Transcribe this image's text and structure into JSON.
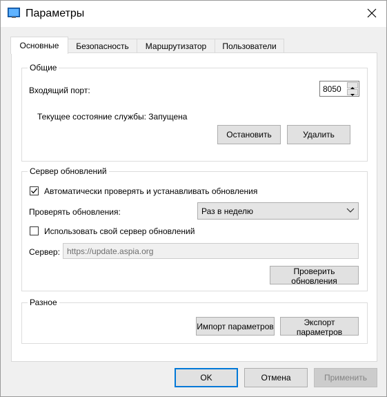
{
  "window": {
    "title": "Параметры"
  },
  "tabs": [
    {
      "label": "Основные"
    },
    {
      "label": "Безопасность"
    },
    {
      "label": "Маршрутизатор"
    },
    {
      "label": "Пользователи"
    }
  ],
  "general": {
    "legend": "Общие",
    "port_label": "Входящий порт:",
    "port_value": "8050",
    "service_status": "Текущее состояние службы: Запущена",
    "stop_button": "Остановить",
    "remove_button": "Удалить"
  },
  "updates": {
    "legend": "Сервер обновлений",
    "auto_check_label": "Автоматически проверять и устанавливать обновления",
    "auto_check_checked": true,
    "check_frequency_label": "Проверять обновления:",
    "check_frequency_value": "Раз в неделю",
    "custom_server_label": "Использовать свой сервер обновлений",
    "custom_server_checked": false,
    "server_label": "Сервер:",
    "server_value": "https://update.aspia.org",
    "check_updates_button": "Проверить обновления"
  },
  "misc": {
    "legend": "Разное",
    "import_button": "Импорт параметров",
    "export_button": "Экспорт параметров"
  },
  "footer": {
    "ok_button": "OK",
    "cancel_button": "Отмена",
    "apply_button": "Применить"
  },
  "colors": {
    "accent": "#0078d7",
    "window_bg": "#f0f0f0",
    "panel_bg": "#ffffff"
  }
}
